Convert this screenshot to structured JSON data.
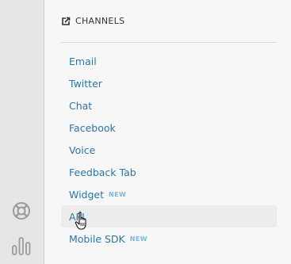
{
  "sidebar": {
    "icons": [
      "lifebuoy-icon",
      "bar-chart-icon"
    ]
  },
  "channels": {
    "header_icon": "share-icon",
    "title": "CHANNELS",
    "items": [
      {
        "label": "Email",
        "badge": ""
      },
      {
        "label": "Twitter",
        "badge": ""
      },
      {
        "label": "Chat",
        "badge": ""
      },
      {
        "label": "Facebook",
        "badge": ""
      },
      {
        "label": "Voice",
        "badge": ""
      },
      {
        "label": "Feedback Tab",
        "badge": ""
      },
      {
        "label": "Widget",
        "badge": "NEW"
      },
      {
        "label": "API",
        "badge": ""
      },
      {
        "label": "Mobile SDK",
        "badge": "NEW"
      }
    ],
    "hovered_item": "API"
  },
  "colors": {
    "link": "#2d76a3",
    "badge": "#7cb7d6",
    "rail_bg": "#e6e6e6",
    "panel_bg": "#f7f7f7"
  }
}
